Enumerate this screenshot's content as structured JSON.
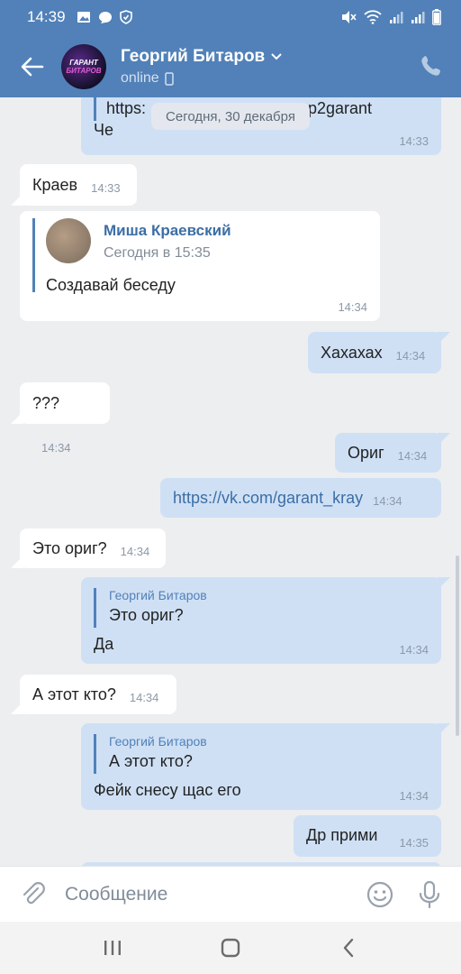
{
  "status_bar": {
    "time": "14:39",
    "left_icons": [
      "image-icon",
      "chat-bubble-icon",
      "shield-icon"
    ],
    "right_icons": [
      "mute-icon",
      "wifi-icon",
      "signal-icon",
      "signal-icon",
      "battery-icon"
    ]
  },
  "header": {
    "name": "Георгий Битаров",
    "status": "online",
    "avatar_text": [
      "ГАРАНТ",
      "БИТАРОВ"
    ],
    "accent_color": "#5181b8"
  },
  "chat": {
    "date_divider": "Сегодня, 30 декабря",
    "messages": [
      {
        "dir": "out",
        "link_partial_left": "https:",
        "link_partial_right": "p2garant",
        "text": "Че",
        "time": "14:33"
      },
      {
        "dir": "in",
        "text": "Краев",
        "time": "14:33"
      },
      {
        "dir": "in",
        "fwd_name": "Миша Краевский",
        "fwd_time": "Сегодня в 15:35",
        "text": "Создавай беседу",
        "time": "14:34"
      },
      {
        "dir": "out",
        "text": "Хахахах",
        "time": "14:34"
      },
      {
        "dir": "in",
        "text": "???",
        "time": "14:34"
      },
      {
        "dir": "out",
        "text": "Ориг",
        "time": "14:34"
      },
      {
        "dir": "out",
        "text": "https://vk.com/garant_kray",
        "time": "14:34"
      },
      {
        "dir": "in",
        "text": "Это ориг?",
        "time": "14:34"
      },
      {
        "dir": "out",
        "reply_name": "Георгий Битаров",
        "reply_text": "Это ориг?",
        "text": "Да",
        "time": "14:34"
      },
      {
        "dir": "in",
        "text": "А этот кто?",
        "time": "14:34"
      },
      {
        "dir": "out",
        "reply_name": "Георгий Битаров",
        "reply_text": "А этот кто?",
        "text": "Фейк снесу щас его",
        "time": "14:34"
      },
      {
        "dir": "out",
        "text": "Др прими",
        "time": "14:35"
      }
    ]
  },
  "composer": {
    "placeholder": "Сообщение"
  }
}
